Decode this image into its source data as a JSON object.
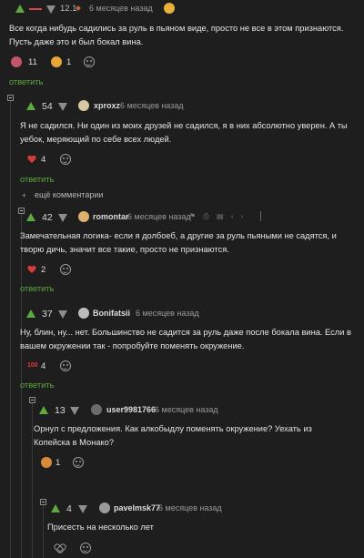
{
  "reply_label": "ответить",
  "more_comments_label": "ещё комментарии",
  "colors": {
    "background": "#1e1e1e",
    "upvote": "#5daa3f",
    "reply": "#5daa3f",
    "heart": "#d63a3a"
  },
  "comments": [
    {
      "rating": "12.1",
      "author": "",
      "time": "6 месяцев назад",
      "text": "Все когда нибудь садились за руль в пьяном виде, просто не все в этом признаются. Пусть даже это и был бокал вина.",
      "reactions": [
        {
          "icon": "angry-cat-icon",
          "count": "11"
        },
        {
          "icon": "facepalm-icon",
          "count": "1"
        }
      ]
    },
    {
      "rating": "54",
      "author": "xproxz",
      "time": "6 месяцев назад",
      "text": "Я не садился. Ни один из моих друзей не садился, я в них абсолютно уверен. А ты уебок, меряющий по себе всех людей.",
      "reactions": [
        {
          "icon": "heart-icon",
          "count": "4"
        }
      ]
    },
    {
      "rating": "42",
      "author": "romontar",
      "time": "6 месяцев назад",
      "text": "Замечательная логика- если я долбоеб, а другие за руль пьяными не садятся, и творю дичь, значит все такие, просто не признаются.",
      "reactions": [
        {
          "icon": "heart-icon",
          "count": "2"
        }
      ]
    },
    {
      "rating": "37",
      "author": "Bonifatsii",
      "time": "6 месяцев назад",
      "text": "Ну, блин, ну... нет. Большинство не садится за руль даже после бокала вина. Если в вашем окружении так - попробуйте поменять окружение.",
      "reactions": [
        {
          "icon": "hundred-points-icon",
          "count": "4"
        }
      ]
    },
    {
      "rating": "13",
      "author": "user9981766",
      "time": "6 месяцев назад",
      "text": "Орнул с предложения. Как алкобыдлу поменять окружение? Уехать из Копейска в Монако?",
      "reactions": [
        {
          "icon": "laughing-cat-icon",
          "count": "1"
        }
      ]
    },
    {
      "rating": "4",
      "author": "pavelmsk77",
      "time": "6 месяцев назад",
      "text": "Присесть на несколько лет",
      "reactions": []
    }
  ]
}
